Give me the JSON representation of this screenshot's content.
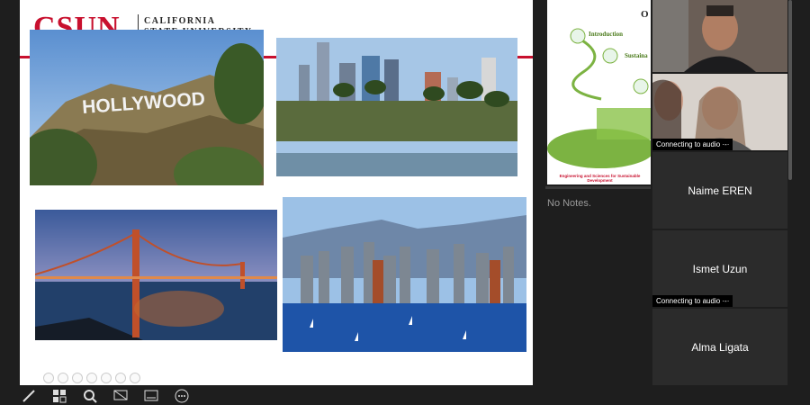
{
  "slide": {
    "logo_text": "CSUN",
    "logo_subtitle_line1": "CALIFORNIA",
    "logo_subtitle_line2": "STATE UNIVERSITY",
    "photos": [
      {
        "name": "hollywood-sign-photo",
        "caption": "HOLLYWOOD"
      },
      {
        "name": "los-angeles-skyline-photo"
      },
      {
        "name": "golden-gate-bridge-photo"
      },
      {
        "name": "san-diego-skyline-photo"
      }
    ]
  },
  "side_panel": {
    "thumb_title": "O",
    "thumb_items": [
      "Introduction",
      "Sustaina"
    ],
    "thumb_footer": "Engineering and Sciences for Sustainable Development",
    "notes_text": "No Notes."
  },
  "participants": [
    {
      "id": "video-1"
    },
    {
      "id": "video-2",
      "status": "Connecting to audio ·-·"
    },
    {
      "id": "tile-naime",
      "name": "Naime EREN"
    },
    {
      "id": "tile-ismet",
      "name": "Ismet Uzun",
      "status": "Connecting to audio ·-·"
    },
    {
      "id": "tile-alma",
      "name": "Alma Ligata"
    }
  ],
  "toolbar": {
    "icons": [
      "pen-icon",
      "grid-icon",
      "search-icon",
      "screen-icon",
      "subtitles-icon",
      "more-icon"
    ]
  },
  "colors": {
    "brand": "#c8102e",
    "background": "#1e1e1e",
    "tile": "#2b2b2b"
  }
}
